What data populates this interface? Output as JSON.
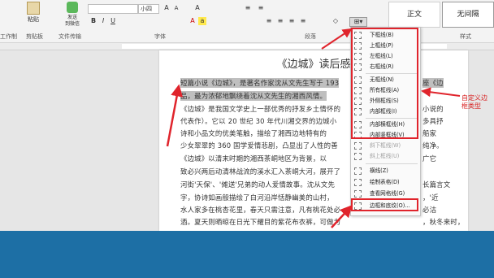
{
  "ribbon": {
    "buttons": {
      "paste": "粘贴",
      "word_art": "发送\n到微信",
      "group_clipboard": "剪贴板",
      "group_font": "字体",
      "group_paragraph": "段落",
      "group_styles": "样式",
      "group_file_transfer": "文件传输",
      "group_left_cut": "工作制"
    },
    "font_name": "",
    "font_size": "小四",
    "styles": [
      "正文",
      "无间隔"
    ]
  },
  "document": {
    "title": "《边城》读后感",
    "lines": [
      "短篇小说《边城》，是著名作家沈从文先生写于 193",
      "品，最为浓郁地飘绕着沈从文先生的湘西风情。",
      "《边城》是我国文学史上一部优秀的抒发乡土情怀的",
      "代表作）。它以 20 世纪 30 年代川湘交界的边城小",
      "诗和小品文的优美笔触，描绘了湘西边地特有的",
      "少女翠翠的 360 国学爱情悲剧，凸显出了人性的善",
      "《边城》以清末时期的湘西茶峒地区为背景，以",
      "致必兴两后动清林战流的溪水汇入茶峒大河，展开了",
      "河街'天保'、'傩送'兄弟的动人爱情故事。沈从文先",
      "字，协诗如画般描绘了白河沿岸恬静幽美的山村，",
      "水人家多在桃杏花里，春天只需注意，凡有桃花处必",
      "酒。夏天则晒晾在日光下耀目的紫花布衣裤，可做为",
      "的小说《边城》，是著名作家沈从文先生写于 193"
    ],
    "right_fragments": [
      "座《边",
      "小说的",
      "多具抒",
      "船家",
      "纯净。",
      "广它",
      "长篇言文",
      "，'近",
      "必沽",
      "，秋冬来时，"
    ]
  },
  "border_menu": {
    "items": [
      {
        "label": "下框线(B)",
        "disabled": false
      },
      {
        "label": "上框线(P)",
        "disabled": false
      },
      {
        "label": "左框线(L)",
        "disabled": false
      },
      {
        "label": "右框线(R)",
        "disabled": false
      },
      {
        "label": "无框线(N)",
        "disabled": false
      },
      {
        "label": "所有框线(A)",
        "disabled": false
      },
      {
        "label": "外侧框线(S)",
        "disabled": false
      },
      {
        "label": "内部框线(I)",
        "disabled": false
      },
      {
        "label": "内部横框线(H)",
        "disabled": false
      },
      {
        "label": "内部竖框线(V)",
        "disabled": false
      },
      {
        "label": "斜下框线(W)",
        "disabled": true
      },
      {
        "label": "斜上框线(U)",
        "disabled": true
      },
      {
        "label": "横线(Z)",
        "disabled": false
      },
      {
        "label": "绘制表格(D)",
        "disabled": false
      },
      {
        "label": "查看网格线(G)",
        "disabled": false
      },
      {
        "label": "边框和底纹(O)...",
        "disabled": false
      }
    ]
  },
  "annotation": {
    "text": "自定义边框类型",
    "color": "#e0242c"
  }
}
